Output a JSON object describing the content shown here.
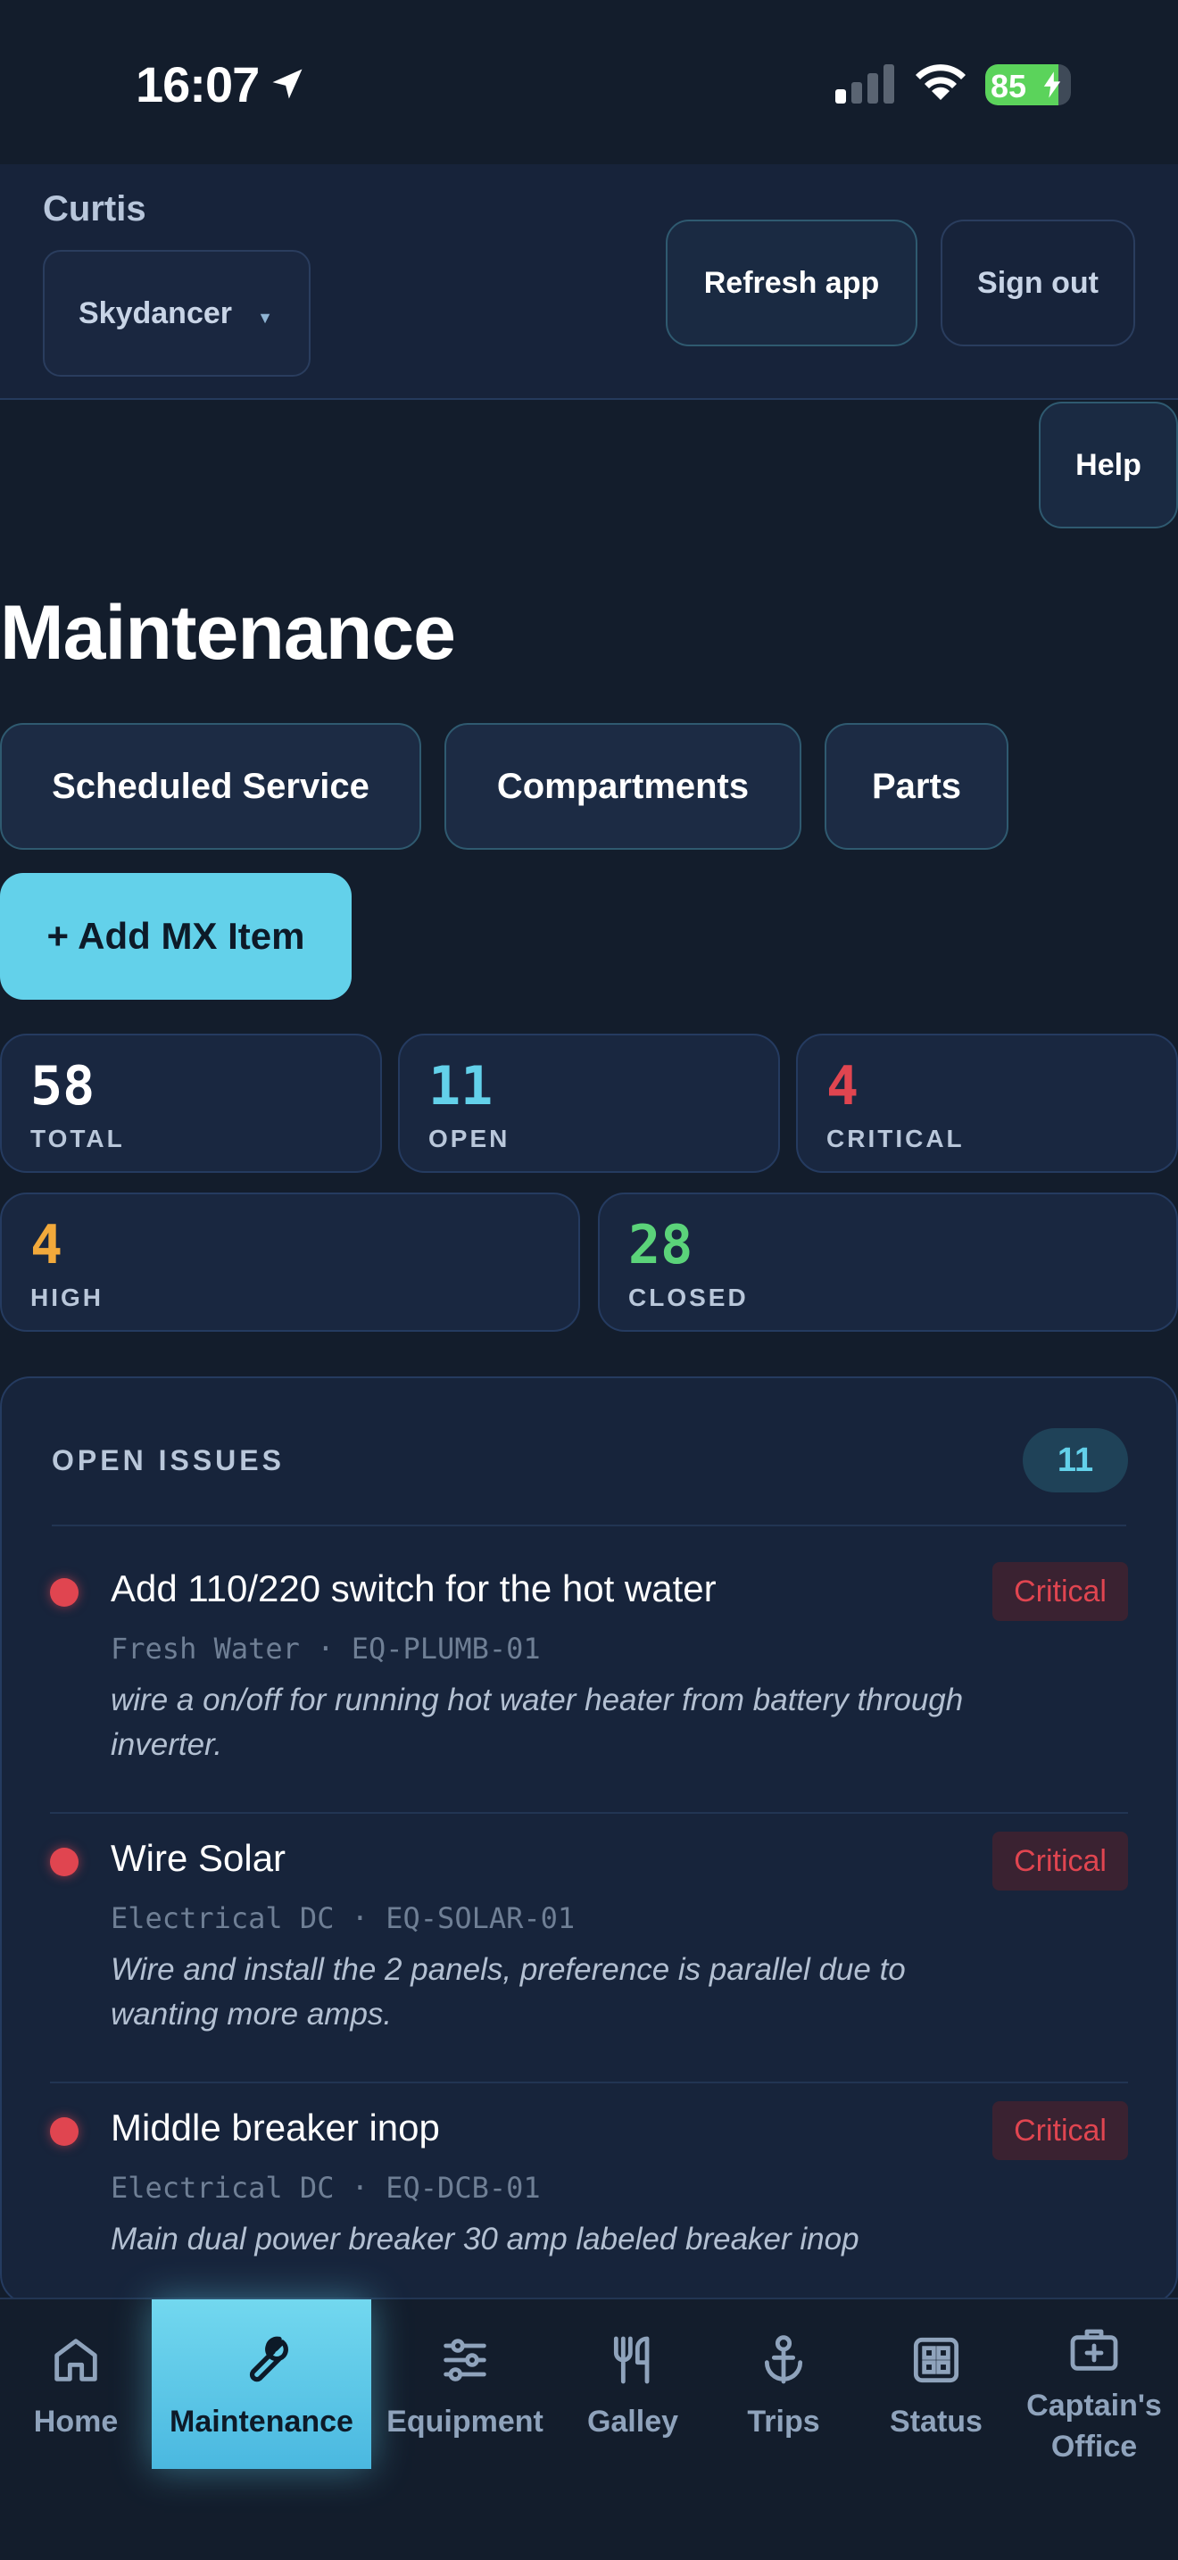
{
  "status_bar": {
    "time": "16:07",
    "battery": "85",
    "battery_level": 0.85
  },
  "header": {
    "user_name": "Curtis",
    "boat": "Skydancer",
    "refresh_label": "Refresh app",
    "signout_label": "Sign out",
    "help_label": "Help"
  },
  "page": {
    "title": "Maintenance",
    "tabs": [
      {
        "label": "Scheduled Service"
      },
      {
        "label": "Compartments"
      },
      {
        "label": "Parts"
      }
    ],
    "add_label": "+ Add MX Item"
  },
  "stats": [
    {
      "value": "58",
      "label": "TOTAL",
      "color": "#ffffff"
    },
    {
      "value": "11",
      "label": "OPEN",
      "color": "#63d1ea"
    },
    {
      "value": "4",
      "label": "CRITICAL",
      "color": "#e04550"
    },
    {
      "value": "4",
      "label": "HIGH",
      "color": "#f2a93b"
    },
    {
      "value": "28",
      "label": "CLOSED",
      "color": "#5bd37a"
    }
  ],
  "open_issues": {
    "heading": "OPEN ISSUES",
    "count": "11",
    "items": [
      {
        "title": "Add 110/220 switch for the hot water",
        "meta": "Fresh Water · EQ-PLUMB-01",
        "description": "wire a on/off for running hot water heater from battery through inverter.",
        "severity": "Critical"
      },
      {
        "title": "Wire Solar",
        "meta": "Electrical DC · EQ-SOLAR-01",
        "description": "Wire and install the 2 panels, preference is parallel due to wanting more amps.",
        "severity": "Critical"
      },
      {
        "title": "Middle breaker inop",
        "meta": "Electrical DC · EQ-DCB-01",
        "description": "Main dual power breaker 30 amp labeled breaker inop",
        "severity": "Critical"
      }
    ]
  },
  "nav": [
    {
      "label": "Home",
      "icon": "home-icon"
    },
    {
      "label": "Maintenance",
      "icon": "wrench-icon",
      "active": true
    },
    {
      "label": "Equipment",
      "icon": "sliders-icon"
    },
    {
      "label": "Galley",
      "icon": "utensils-icon"
    },
    {
      "label": "Trips",
      "icon": "anchor-icon"
    },
    {
      "label": "Status",
      "icon": "grid-icon"
    },
    {
      "label": "Captain's Office",
      "icon": "briefcase-icon"
    }
  ],
  "colors": {
    "accent": "#63d1ea",
    "critical": "#e04550",
    "background": "#131d2c"
  }
}
